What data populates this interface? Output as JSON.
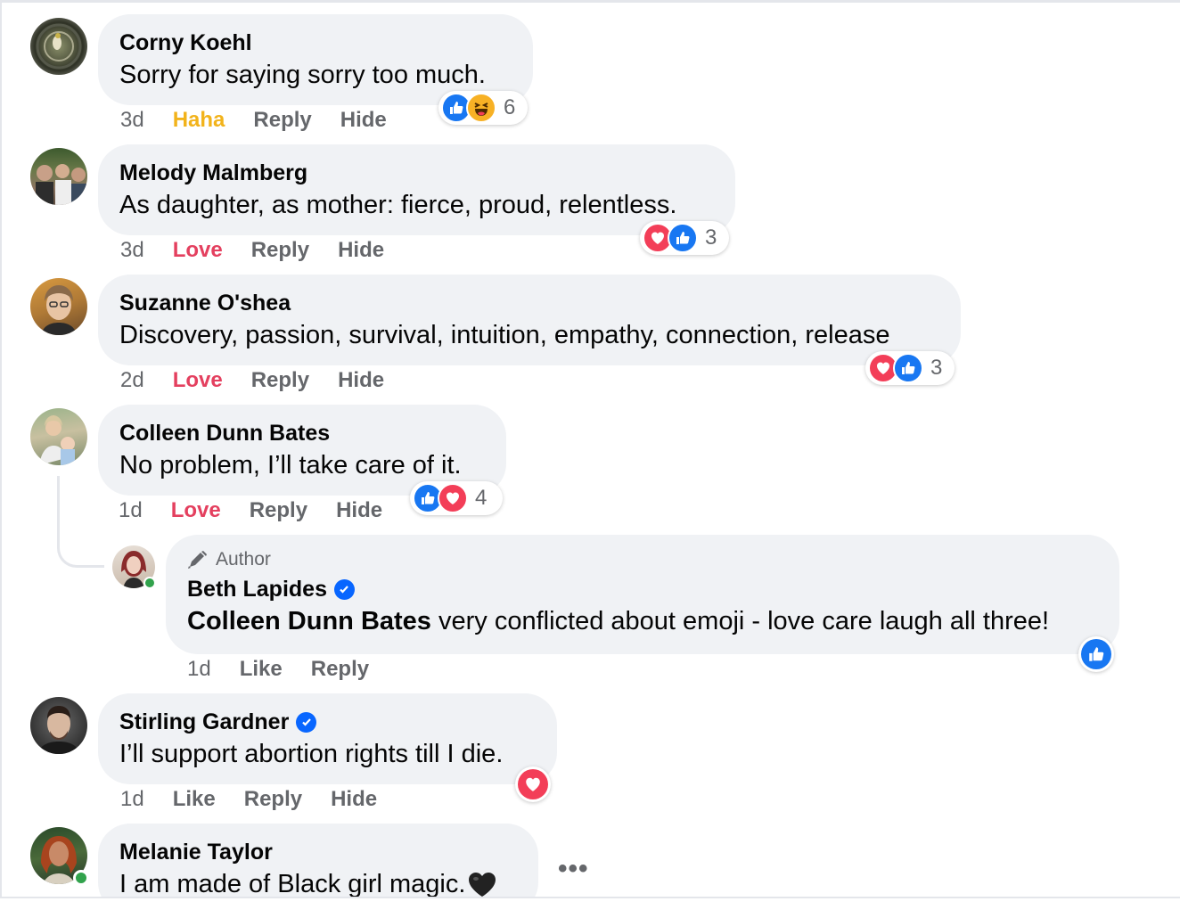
{
  "colors": {
    "bubble": "#f0f2f5",
    "meta": "#65676b",
    "haha": "#f2b31b",
    "love": "#e4405f",
    "like_blue": "#1877f2"
  },
  "comments": [
    {
      "name": "Corny Koehl",
      "text": "Sorry for saying sorry too much.",
      "time": "3d",
      "reaction_label": "Haha",
      "reply": "Reply",
      "hide": "Hide",
      "reactions": [
        "like-icon",
        "haha-icon"
      ],
      "reaction_count": "6"
    },
    {
      "name": "Melody Malmberg",
      "text": "As daughter, as mother: fierce, proud, relentless.",
      "time": "3d",
      "reaction_label": "Love",
      "reply": "Reply",
      "hide": "Hide",
      "reactions": [
        "love-icon",
        "like-icon"
      ],
      "reaction_count": "3"
    },
    {
      "name": "Suzanne O'shea",
      "text": "Discovery, passion, survival, intuition, empathy, connection, release",
      "time": "2d",
      "reaction_label": "Love",
      "reply": "Reply",
      "hide": "Hide",
      "reactions": [
        "love-icon",
        "like-icon"
      ],
      "reaction_count": "3"
    },
    {
      "name": "Colleen Dunn Bates",
      "text": "No problem, I’ll take care of it.",
      "time": "1d",
      "reaction_label": "Love",
      "reply": "Reply",
      "hide": "Hide",
      "reactions": [
        "like-icon",
        "love-icon"
      ],
      "reaction_count": "4"
    },
    {
      "name": "Stirling Gardner",
      "verified": true,
      "text": "I’ll support abortion rights till I die.",
      "time": "1d",
      "reaction_label": "Like",
      "reply": "Reply",
      "hide": "Hide",
      "reactions": [
        "love-icon"
      ]
    },
    {
      "name": "Melanie Taylor",
      "text": "I am made of Black girl magic.",
      "emoji": "black-heart-icon",
      "online": true
    }
  ],
  "reply": {
    "badge": "Author",
    "badge_icon": "pen-icon",
    "name": "Beth Lapides",
    "verified": true,
    "mention": "Colleen Dunn Bates",
    "text": " very conflicted about emoji - love care laugh all three!",
    "time": "1d",
    "like": "Like",
    "reply": "Reply",
    "reactions": [
      "like-icon"
    ],
    "online": true
  },
  "more_label": "•••"
}
